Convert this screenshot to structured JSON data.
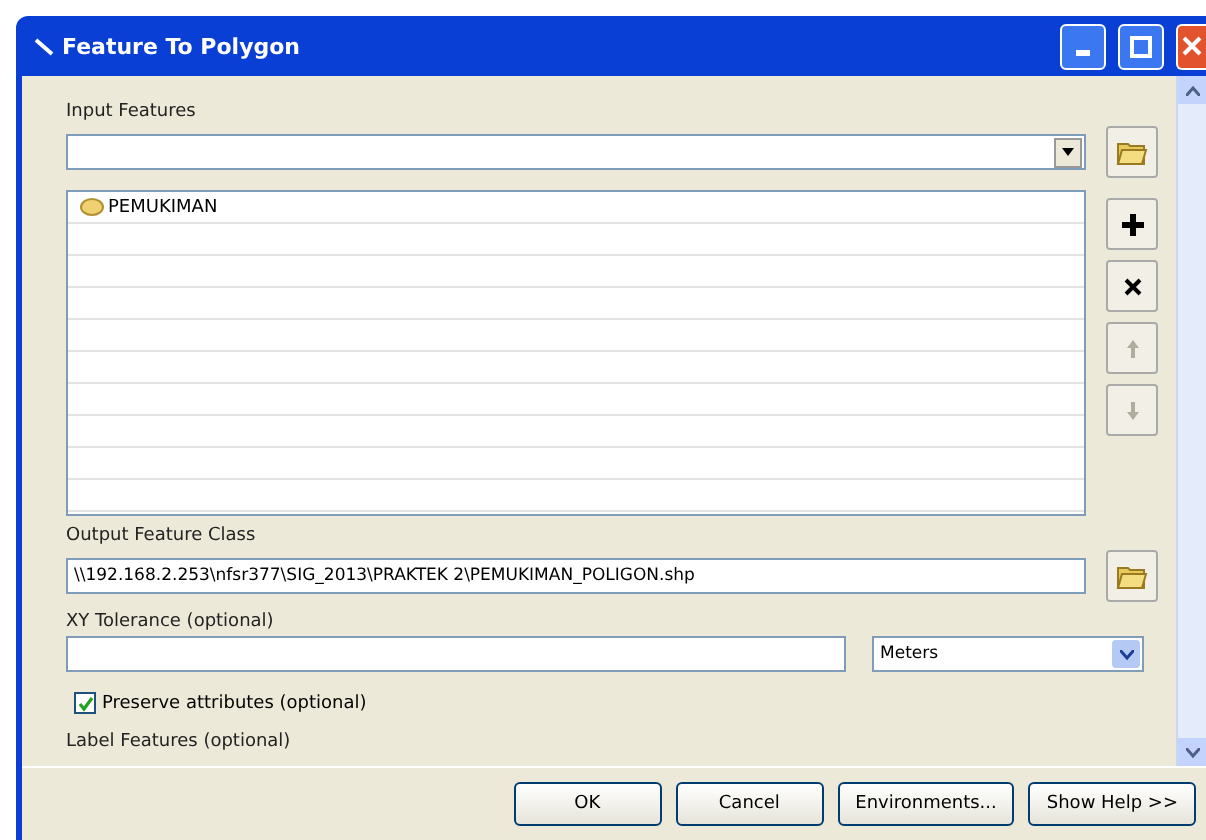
{
  "window": {
    "title": "Feature To Polygon"
  },
  "input_features": {
    "label": "Input Features",
    "items": [
      {
        "name": "PEMUKIMAN"
      }
    ]
  },
  "side_buttons": [
    {
      "kind": "add",
      "disabled": false
    },
    {
      "kind": "remove",
      "disabled": false
    },
    {
      "kind": "up",
      "disabled": true
    },
    {
      "kind": "down",
      "disabled": true
    }
  ],
  "output_feature_class": {
    "label": "Output Feature Class",
    "value": "\\\\192.168.2.253\\nfsr377\\SIG_2013\\PRAKTEK 2\\PEMUKIMAN_POLIGON.shp"
  },
  "xy_tolerance": {
    "label": "XY Tolerance (optional)",
    "unit": "Meters"
  },
  "preserve_attributes": {
    "label": "Preserve attributes (optional)",
    "checked": true
  },
  "label_features": {
    "label": "Label Features (optional)"
  },
  "buttons": [
    "OK",
    "Cancel",
    "Environments...",
    "Show Help >>"
  ]
}
